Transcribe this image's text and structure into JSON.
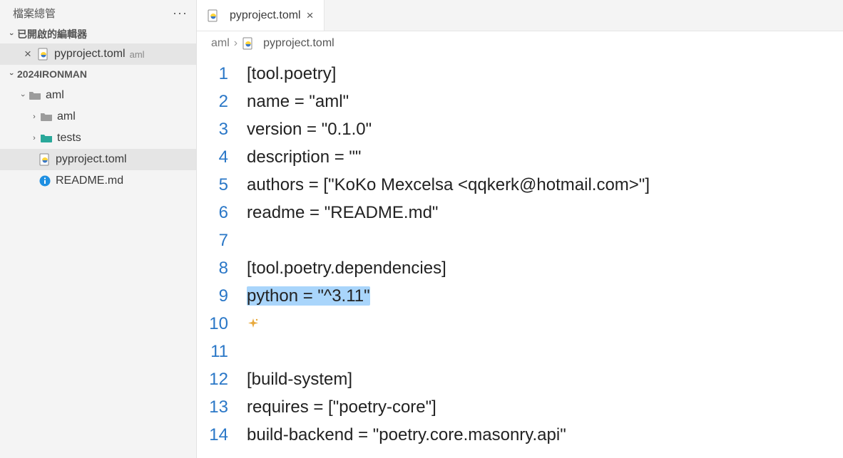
{
  "sidebar": {
    "title": "檔案總管",
    "openEditorsLabel": "已開啟的編輯器",
    "projectName": "2024IRONMAN",
    "openFile": {
      "name": "pyproject.toml",
      "folder": "aml"
    },
    "tree": {
      "rootFolder": "aml",
      "subFolders": [
        "aml",
        "tests"
      ],
      "files": [
        "pyproject.toml",
        "README.md"
      ]
    }
  },
  "tab": {
    "name": "pyproject.toml"
  },
  "breadcrumb": {
    "parent": "aml",
    "file": "pyproject.toml"
  },
  "code": {
    "lines": [
      "[tool.poetry]",
      "name = \"aml\"",
      "version = \"0.1.0\"",
      "description = \"\"",
      "authors = [\"KoKo Mexcelsa <qqkerk@hotmail.com>\"]",
      "readme = \"README.md\"",
      "",
      "[tool.poetry.dependencies]",
      "python = \"^3.11\"",
      "",
      "",
      "[build-system]",
      "requires = [\"poetry-core\"]",
      "build-backend = \"poetry.core.masonry.api\""
    ],
    "highlightedLine": 9,
    "sparkleLine": 10
  }
}
